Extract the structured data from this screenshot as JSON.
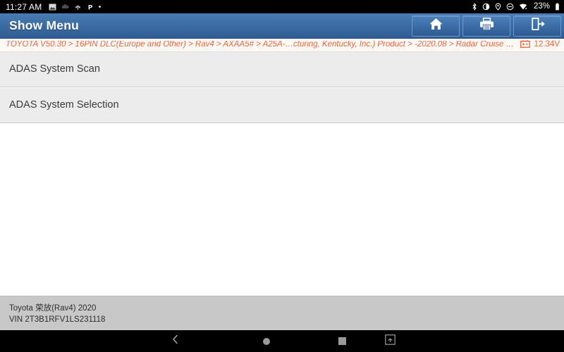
{
  "statusbar": {
    "clock": "11:27 AM",
    "left_icons": [
      "image-icon",
      "weather-icon",
      "usb-icon",
      "parking-icon",
      "dot-icon"
    ],
    "right_icons": [
      "bluetooth-icon",
      "brightness-icon",
      "location-icon",
      "do-not-disturb-icon",
      "wifi-icon"
    ],
    "battery_percent": "23%",
    "battery_icon": "battery-icon"
  },
  "titlebar": {
    "title": "Show Menu",
    "buttons": [
      {
        "name": "home-button",
        "icon": "home-icon"
      },
      {
        "name": "print-button",
        "icon": "printer-icon"
      },
      {
        "name": "exit-button",
        "icon": "exit-icon"
      }
    ],
    "colors": {
      "gradient_top": "#4a7cb5",
      "gradient_bottom": "#2f5c93"
    }
  },
  "pathbar": {
    "breadcrumb": "TOYOTA V50.30 > 16PIN DLC(Europe and Other) > Rav4 > AXAA5# > A25A-…cturing, Kentucky, Inc.) Product > -2020.08 > Radar Cruise > w/ Smart Key",
    "battery_icon": "car-battery-icon",
    "voltage": "12.34V",
    "accent_color": "#f4623f"
  },
  "menu": {
    "items": [
      {
        "label": "ADAS System Scan"
      },
      {
        "label": "ADAS System Selection"
      }
    ]
  },
  "footer": {
    "vehicle": "Toyota 荣放(Rav4) 2020",
    "vin": "VIN 2T3B1RFV1LS231118"
  },
  "navbar": {
    "buttons": [
      {
        "name": "nav-back-button",
        "icon": "chevron-left-icon"
      },
      {
        "name": "nav-home-button",
        "icon": "circle-icon"
      },
      {
        "name": "nav-recents-button",
        "icon": "square-icon"
      },
      {
        "name": "nav-screenshot-button",
        "icon": "screenshot-icon"
      }
    ]
  }
}
